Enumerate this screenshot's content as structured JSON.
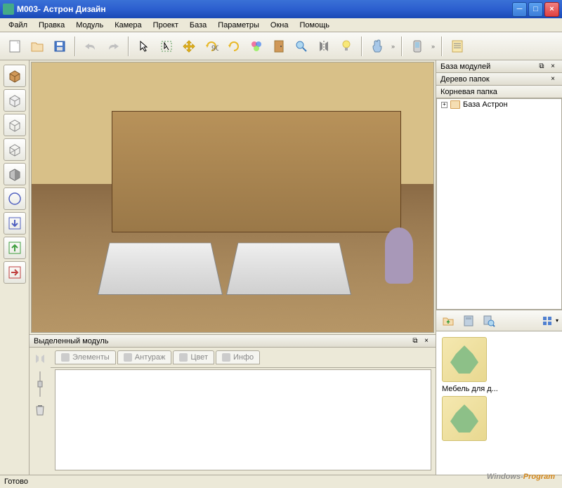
{
  "title": "M003- Астрон Дизайн",
  "menu": [
    "Файл",
    "Правка",
    "Модуль",
    "Камера",
    "Проект",
    "База",
    "Параметры",
    "Окна",
    "Помощь"
  ],
  "bottom_panel": {
    "title": "Выделенный модуль",
    "tabs": [
      "Элементы",
      "Антураж",
      "Цвет",
      "Инфо"
    ]
  },
  "right_panel": {
    "title": "База модулей",
    "sub_title": "Дерево папок",
    "root_label": "Корневая папка",
    "tree_item": "База Астрон"
  },
  "library": {
    "item1": "Мебель для д..."
  },
  "status": "Готово",
  "watermark_a": "Windows-",
  "watermark_b": "Program"
}
